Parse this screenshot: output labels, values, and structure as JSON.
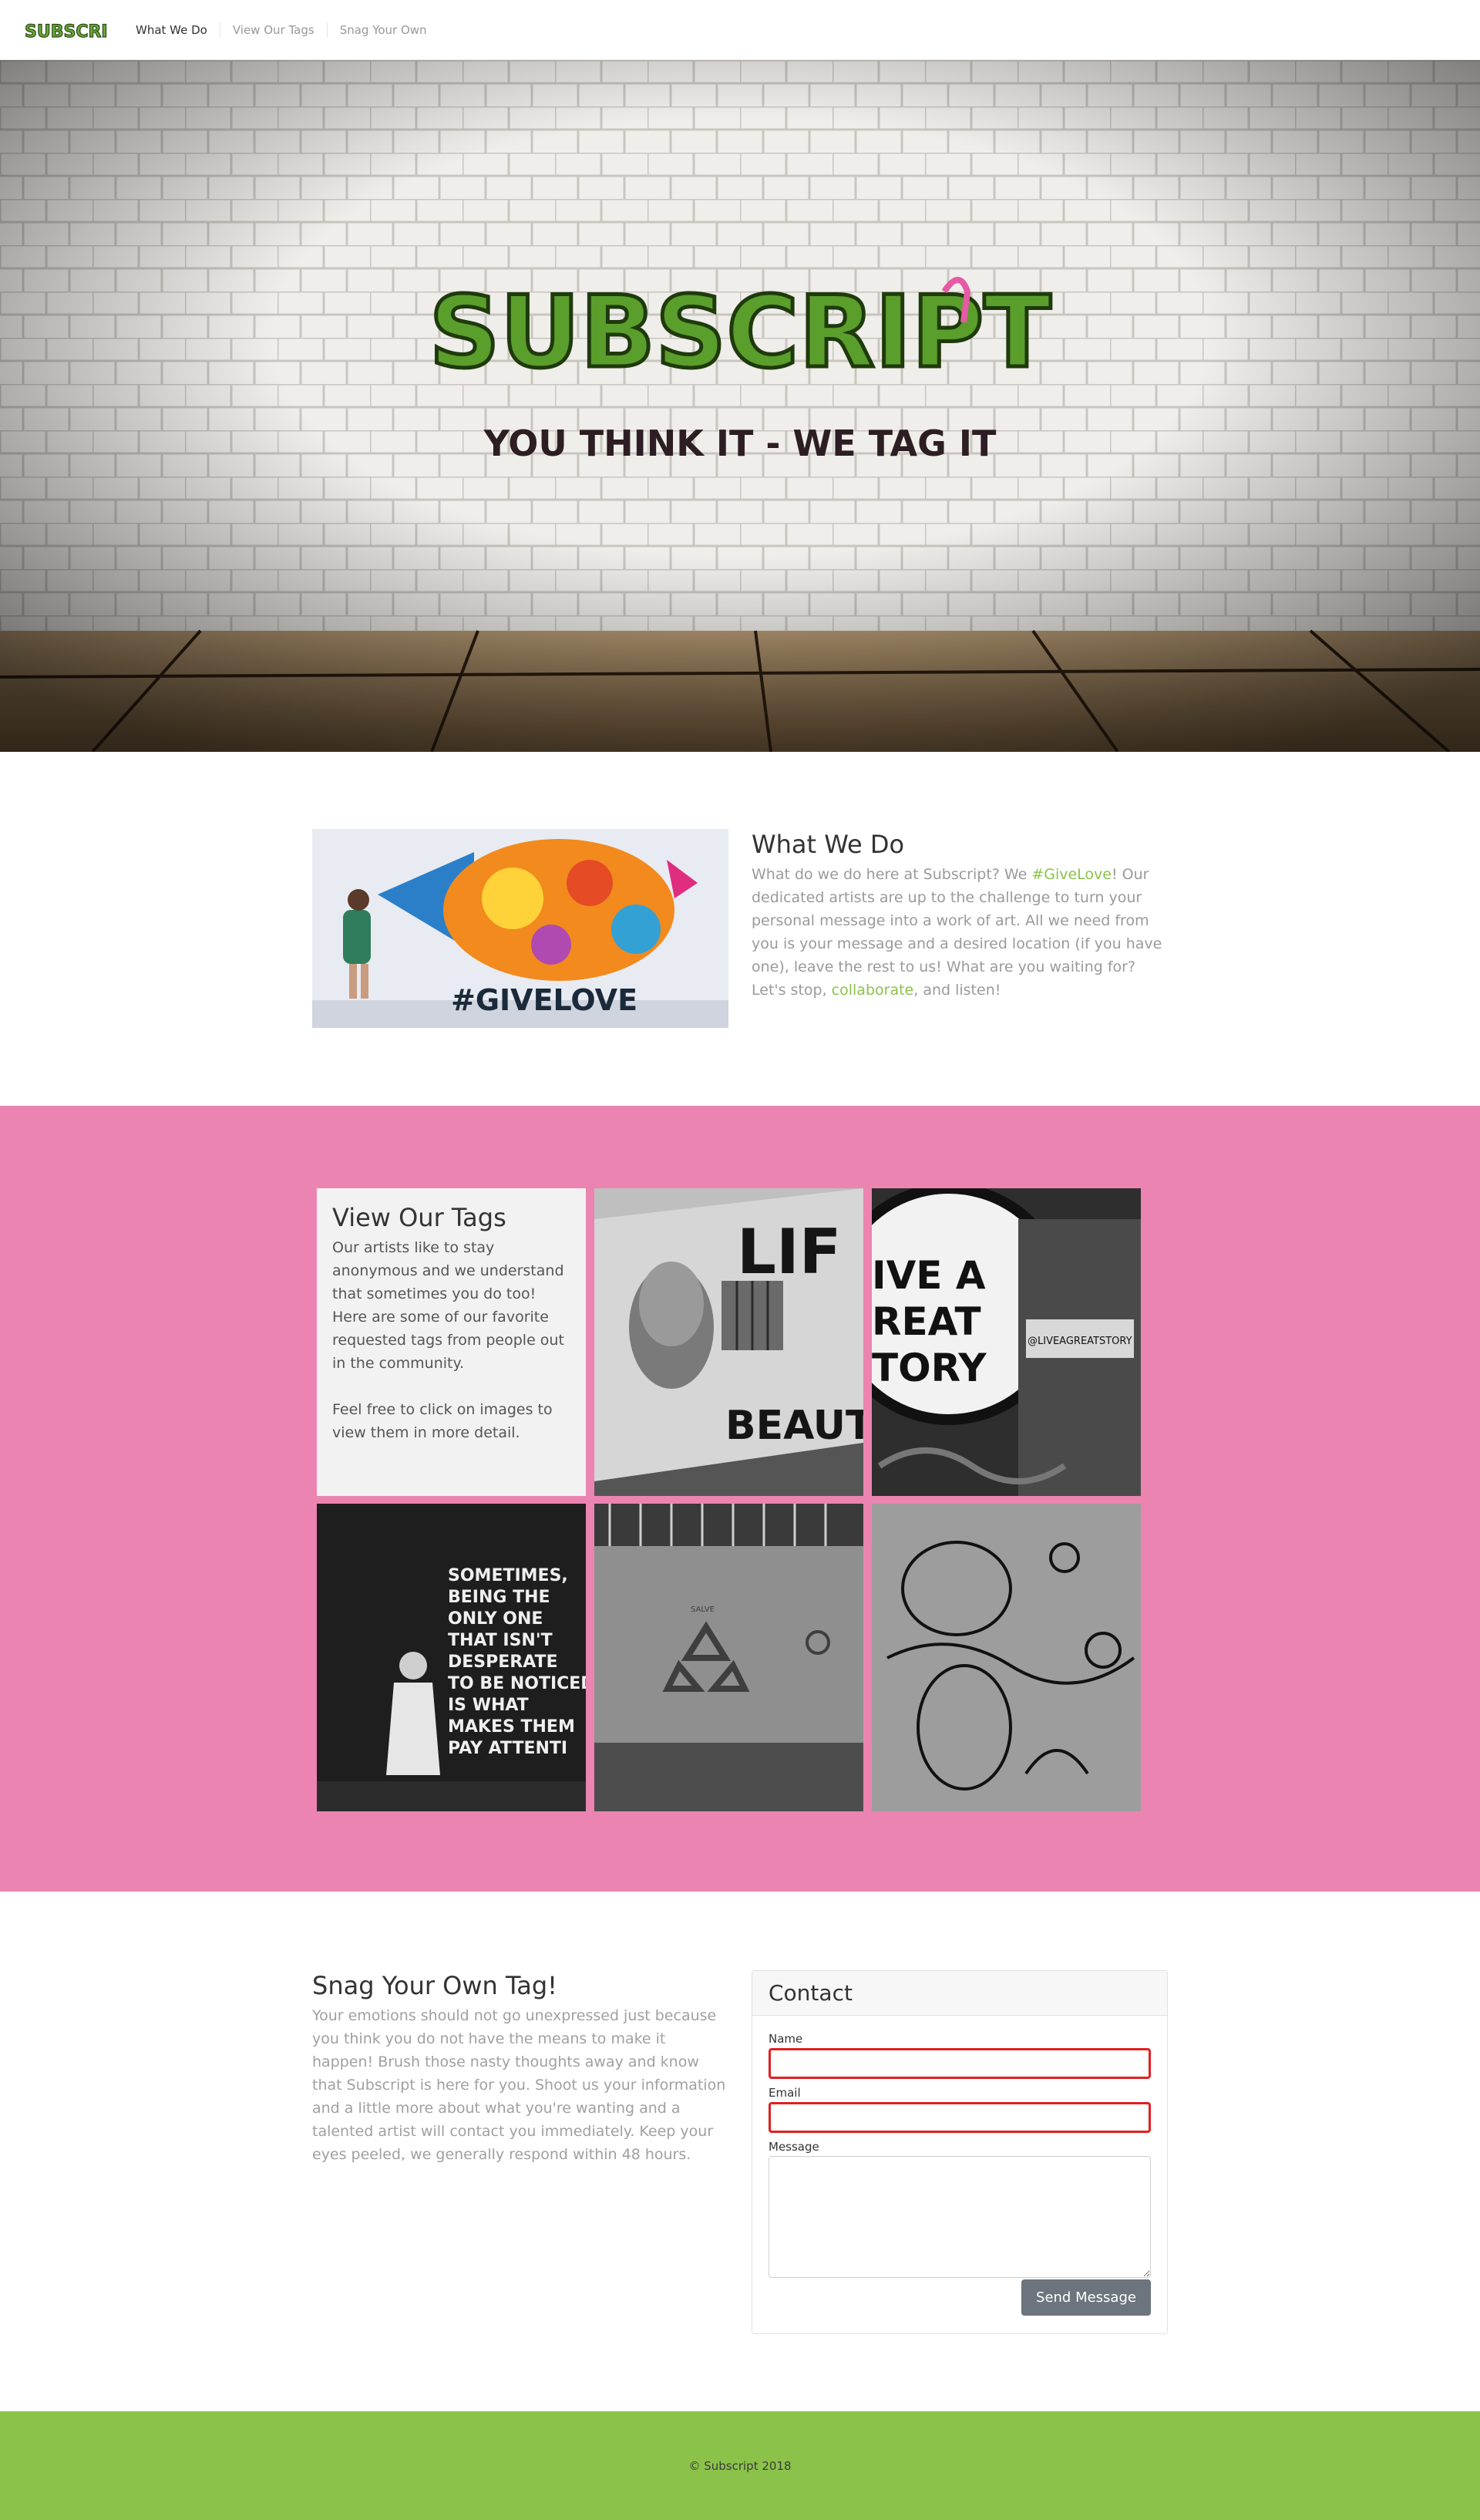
{
  "brand": {
    "logo_text": "SUBSCRIPT",
    "tagline": "YOU THINK IT - WE TAG IT",
    "green": "#8bc34a",
    "pink": "#ec84b1"
  },
  "nav": {
    "items": [
      {
        "label": "What We Do",
        "active": true
      },
      {
        "label": "View Our Tags",
        "active": false
      },
      {
        "label": "Snag Your Own",
        "active": false
      }
    ]
  },
  "what_we_do": {
    "heading": "What We Do",
    "body_1": "What do we do here at Subscript? We ",
    "link_1": "#GiveLove",
    "body_2": "! Our dedicated artists are up to the challenge to turn your personal message into a work of art. All we need from you is your message and a desired location (if you have one), leave the rest to us! What are you waiting for? Let's stop, ",
    "link_2": "collaborate",
    "body_3": ", and listen!",
    "image_text": "#GIVELOVE"
  },
  "tags": {
    "heading": "View Our Tags",
    "para_1": "Our artists like to stay anonymous and we understand that sometimes you do too! Here are some of our favorite requested tags from people out in the community.",
    "para_2": "Feel free to click on images to view them in more detail.",
    "photos": [
      {
        "text_1": "LIF",
        "text_2": "BEAUTI"
      },
      {
        "text_1": "IVE A",
        "text_2": "REAT",
        "text_3": "TORY",
        "text_4": "@LIVEAGREATSTORY"
      },
      {
        "lines": [
          "SOMETIMES,",
          "BEING THE",
          "ONLY ONE",
          "THAT ISN'T",
          "DESPERATE",
          "TO BE NOTICED",
          "IS WHAT",
          "MAKES THEM",
          "PAY ATTENTI"
        ]
      },
      {
        "text_1": "SALVE"
      },
      {}
    ]
  },
  "snag": {
    "heading": "Snag Your Own Tag!",
    "body": "Your emotions should not go unexpressed just because you think you do not have the means to make it happen! Brush those nasty thoughts away and know that Subscript is here for you. Shoot us your information and a little more about what you're wanting and a talented artist will contact you immediately. Keep your eyes peeled, we generally respond within 48 hours."
  },
  "contact": {
    "title": "Contact",
    "name_label": "Name",
    "name_value": "",
    "email_label": "Email",
    "email_value": "",
    "message_label": "Message",
    "message_value": "",
    "submit_label": "Send Message"
  },
  "footer": {
    "copyright": "© Subscript 2018"
  }
}
